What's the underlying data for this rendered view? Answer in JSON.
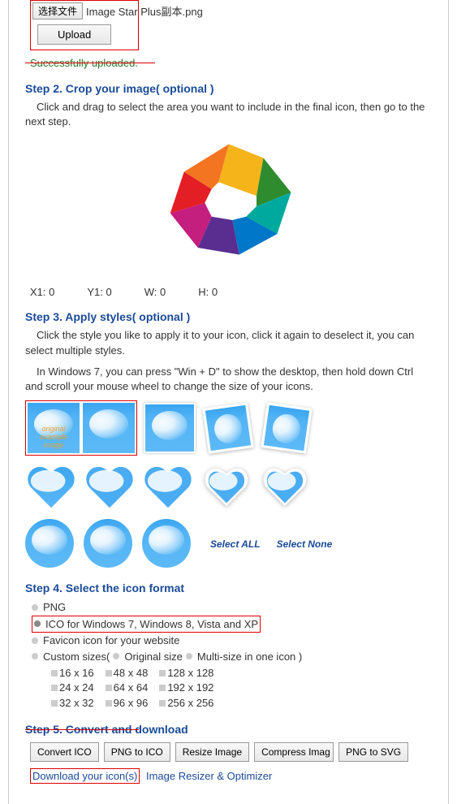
{
  "step1": {
    "choose_btn": "选择文件",
    "filename": "Image Star Plus副本.png",
    "upload_btn": "Upload",
    "success": "Successfully uploaded."
  },
  "step2": {
    "title": "Step 2. Crop your image( optional )",
    "text": "Click and drag to select the area you want to include in the final icon, then go to the next step.",
    "coords": {
      "x1": "X1: 0",
      "y1": "Y1: 0",
      "w": "W: 0",
      "h": "H: 0"
    }
  },
  "step3": {
    "title": "Step 3. Apply styles( optional )",
    "text1": "Click the style you like to apply it to your icon, click it again to deselect it, you can select multiple styles.",
    "text2": "In Windows 7, you can press \"Win + D\" to show the desktop, then hold down Ctrl and scroll your mouse wheel to change the size of your icons.",
    "orig_label_1": "original",
    "orig_label_2": "example",
    "orig_label_3": "image",
    "select_all": "Select ALL",
    "select_none": "Select None"
  },
  "step4": {
    "title": "Step 4. Select the icon format",
    "opt_png": "PNG",
    "opt_ico": "ICO for Windows 7, Windows 8, Vista and XP",
    "opt_favicon": "Favicon icon for your website",
    "opt_custom": "Custom sizes(",
    "orig_size": "Original size",
    "multi_size": "Multi-size in one icon )",
    "sizes": {
      "col1": [
        "16 x 16",
        "24 x 24",
        "32 x 32"
      ],
      "col2": [
        "48 x 48",
        "64 x 64",
        "96 x 96"
      ],
      "col3": [
        "128 x 128",
        "192 x 192",
        "256 x 256"
      ]
    }
  },
  "step5": {
    "title": "Step 5. Convert and download",
    "btn_convert": "Convert ICO",
    "btn_png2ico": "PNG to ICO",
    "btn_resize": "Resize Image",
    "btn_compress": "Compress Imag",
    "btn_png2svg": "PNG to SVG",
    "download_link": "Download your icon(s)",
    "optimizer": "Image Resizer & Optimizer"
  }
}
